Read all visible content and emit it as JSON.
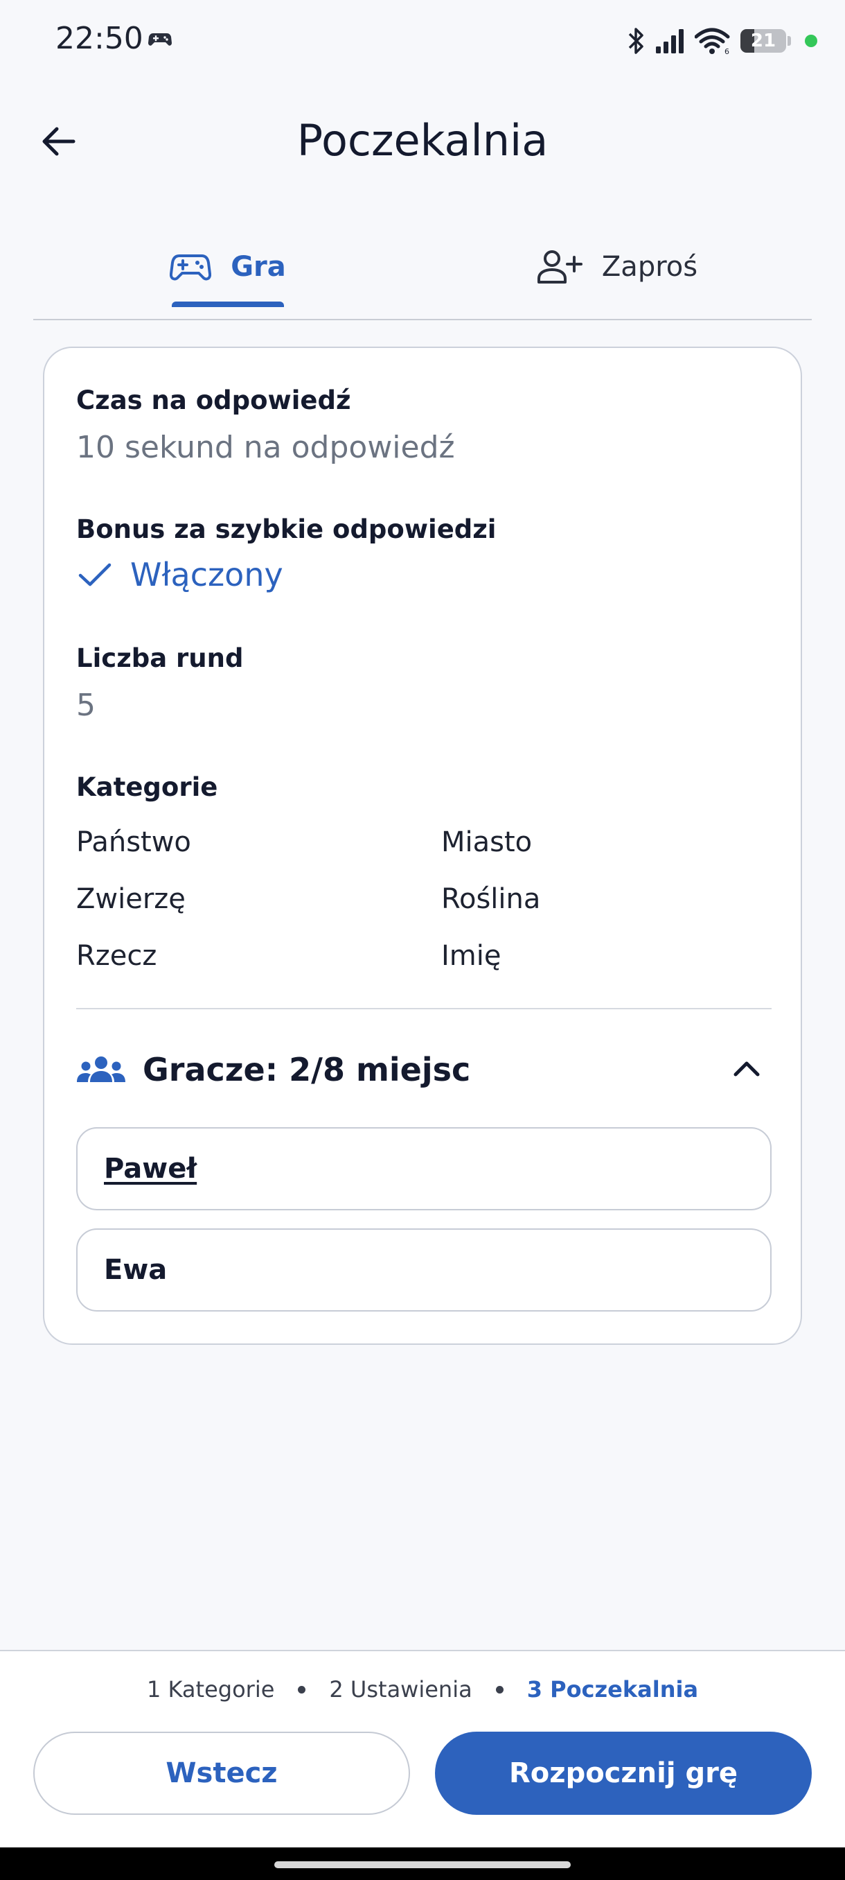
{
  "status_bar": {
    "time": "22:50",
    "battery_level": "21",
    "icons": [
      "gamepad-icon",
      "bluetooth-icon",
      "signal-icon",
      "wifi-icon",
      "battery-icon"
    ]
  },
  "app_bar": {
    "title": "Poczekalnia",
    "back_icon": "arrow-left-icon"
  },
  "tabs": [
    {
      "label": "Gra",
      "icon": "gamepad-icon",
      "active": true
    },
    {
      "label": "Zaproś",
      "icon": "person-add-icon",
      "active": false
    }
  ],
  "settings": {
    "time_label": "Czas na odpowiedź",
    "time_value": "10 sekund na odpowiedź",
    "bonus_label": "Bonus za szybkie odpowiedzi",
    "bonus_value": "Włączony",
    "rounds_label": "Liczba rund",
    "rounds_value": "5",
    "categories_label": "Kategorie",
    "categories": [
      "Państwo",
      "Miasto",
      "Zwierzę",
      "Roślina",
      "Rzecz",
      "Imię"
    ]
  },
  "players": {
    "title": "Gracze: 2/8 miejsc",
    "list": [
      {
        "name": "Paweł",
        "is_me": true
      },
      {
        "name": "Ewa",
        "is_me": false
      }
    ]
  },
  "steps": [
    {
      "label": "1 Kategorie",
      "active": false
    },
    {
      "label": "2 Ustawienia",
      "active": false
    },
    {
      "label": "3 Poczekalnia",
      "active": true
    }
  ],
  "buttons": {
    "back": "Wstecz",
    "start": "Rozpocznij grę"
  },
  "colors": {
    "accent": "#2c62be",
    "background": "#f7f8fb",
    "muted_text": "#6b7381"
  }
}
